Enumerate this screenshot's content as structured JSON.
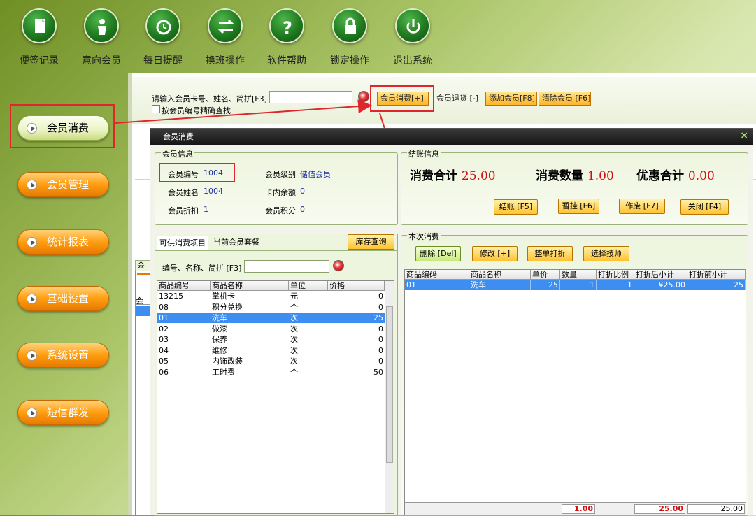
{
  "toolbar": [
    {
      "label": "便签记录",
      "icon": "note-icon"
    },
    {
      "label": "意向会员",
      "icon": "person-icon"
    },
    {
      "label": "每日提醒",
      "icon": "alarm-clock-icon"
    },
    {
      "label": "换班操作",
      "icon": "swap-icon"
    },
    {
      "label": "软件帮助",
      "icon": "help-icon"
    },
    {
      "label": "锁定操作",
      "icon": "lock-icon"
    },
    {
      "label": "退出系统",
      "icon": "power-icon"
    }
  ],
  "menu": [
    "会员消费",
    "会员管理",
    "统计报表",
    "基础设置",
    "系统设置",
    "短信群发"
  ],
  "search": {
    "label": "请输入会员卡号、姓名、简拼[F3]",
    "exact_label": "按会员编号精确查找",
    "buttons": [
      "会员消费[+]",
      "会员退货 [-]",
      "添加会员[F8]",
      "清除会员 [F6]"
    ]
  },
  "bg_fragments": {
    "tab": "会员",
    "label": "会员"
  },
  "dialog": {
    "title": "会员消费",
    "close": "×",
    "member": {
      "group": "会员信息",
      "id_label": "会员编号",
      "id": "1004",
      "level_label": "会员级别",
      "level": "储值会员",
      "name_label": "会员姓名",
      "name": "1004",
      "balance_label": "卡内余额",
      "balance": "0",
      "discount_label": "会员折扣",
      "discount": "1",
      "points_label": "会员积分",
      "points": "0"
    },
    "checkout": {
      "group": "结账信息",
      "total_label": "消费合计",
      "total": "25.00",
      "qty_label": "消费数量",
      "qty": "1.00",
      "disc_label": "优惠合计",
      "disc": "0.00",
      "buttons": [
        "结账 [F5]",
        "暂挂 [F6]",
        "作废 [F7]",
        "关闭 [F4]"
      ]
    },
    "tabs": [
      "可供消费项目",
      "当前会员套餐"
    ],
    "stock_button": "库存查询",
    "item_search_label": "编号、名称、简拼 [F3]",
    "items": {
      "columns": [
        "商品编号",
        "商品名称",
        "单位",
        "价格"
      ],
      "rows": [
        [
          "13215",
          "掌机卡",
          "元",
          "0"
        ],
        [
          "08",
          "积分兑换",
          "个",
          "0"
        ],
        [
          "01",
          "洗车",
          "次",
          "25"
        ],
        [
          "02",
          "做漆",
          "次",
          "0"
        ],
        [
          "03",
          "保养",
          "次",
          "0"
        ],
        [
          "04",
          "维修",
          "次",
          "0"
        ],
        [
          "05",
          "内饰改装",
          "次",
          "0"
        ],
        [
          "06",
          "工时费",
          "个",
          "50"
        ]
      ],
      "selected": 2
    },
    "current": {
      "group": "本次消费",
      "buttons": [
        "删除 [Del]",
        "修改 [+]",
        "整单打折",
        "选择技师"
      ],
      "columns": [
        "商品编码",
        "商品名称",
        "单价",
        "数量",
        "打折比例",
        "打折后小计",
        "打折前小计"
      ],
      "rows": [
        [
          "01",
          "洗车",
          "25",
          "1",
          "1",
          "¥25.00",
          "25"
        ]
      ],
      "footer": {
        "qty": "1.00",
        "after": "25.00",
        "before": "25.00"
      }
    }
  }
}
